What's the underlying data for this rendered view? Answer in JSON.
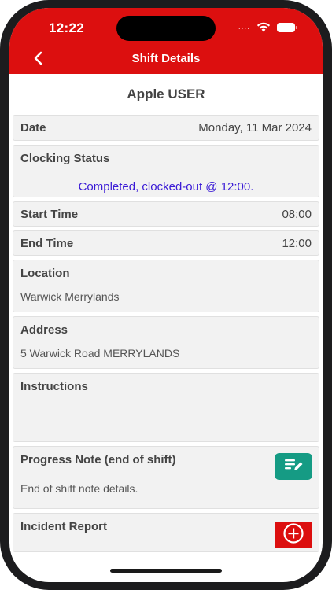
{
  "status_bar": {
    "time": "12:22",
    "signal": "...."
  },
  "header": {
    "title": "Shift Details"
  },
  "user": {
    "name": "Apple USER"
  },
  "date": {
    "label": "Date",
    "value": "Monday, 11 Mar 2024"
  },
  "clocking": {
    "label": "Clocking Status",
    "value": "Completed, clocked-out @ 12:00."
  },
  "start_time": {
    "label": "Start Time",
    "value": "08:00"
  },
  "end_time": {
    "label": "End Time",
    "value": "12:00"
  },
  "location": {
    "label": "Location",
    "value": "Warwick Merrylands"
  },
  "address": {
    "label": "Address",
    "value": "5 Warwick Road MERRYLANDS"
  },
  "instructions": {
    "label": "Instructions",
    "value": ""
  },
  "progress_note": {
    "label": "Progress Note (end of shift)",
    "value": "End of shift note details.",
    "icon": "edit-note-icon"
  },
  "incident": {
    "label": "Incident Report",
    "icon": "plus-circle-icon"
  },
  "colors": {
    "header": "#dc0f0f",
    "note_button": "#159b84",
    "status_text": "#3a1ad6"
  }
}
